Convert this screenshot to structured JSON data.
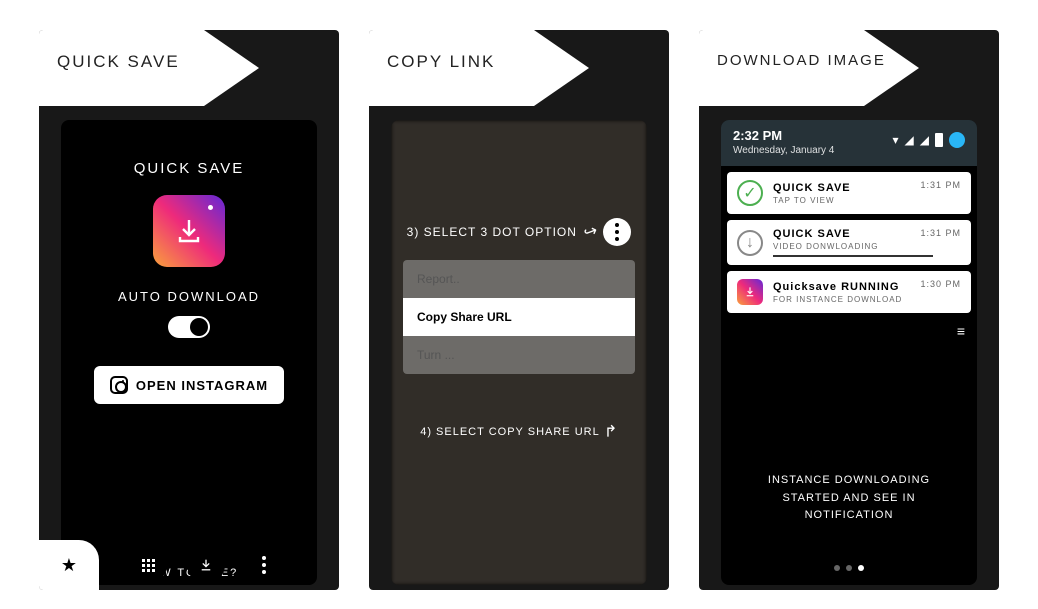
{
  "panels": [
    {
      "banner": "QUICK SAVE",
      "header": "QUICK SAVE",
      "auto_label": "AUTO DOWNLOAD",
      "open_label": "OPEN INSTAGRAM",
      "howto": "HOW TO USE?"
    },
    {
      "banner": "COPY LINK",
      "step3": "3) SELECT 3 DOT OPTION",
      "menu": {
        "report": "Report..",
        "copy": "Copy Share URL",
        "turn": "Turn ..."
      },
      "step4": "4) SELECT COPY SHARE URL"
    },
    {
      "banner": "DOWNLOAD IMAGE",
      "status": {
        "time": "2:32 PM",
        "date": "Wednesday, January 4"
      },
      "notifs": [
        {
          "title": "QUICK SAVE",
          "sub": "TAP TO VIEW",
          "time": "1:31 PM"
        },
        {
          "title": "QUICK SAVE",
          "sub": "VIDEO DONWLOADING",
          "time": "1:31 PM"
        },
        {
          "title": "Quicksave RUNNING",
          "sub": "FOR INSTANCE DOWNLOAD",
          "time": "1:30 PM"
        }
      ],
      "message": "INSTANCE DOWNLOADING STARTED AND SEE IN NOTIFICATION"
    }
  ]
}
